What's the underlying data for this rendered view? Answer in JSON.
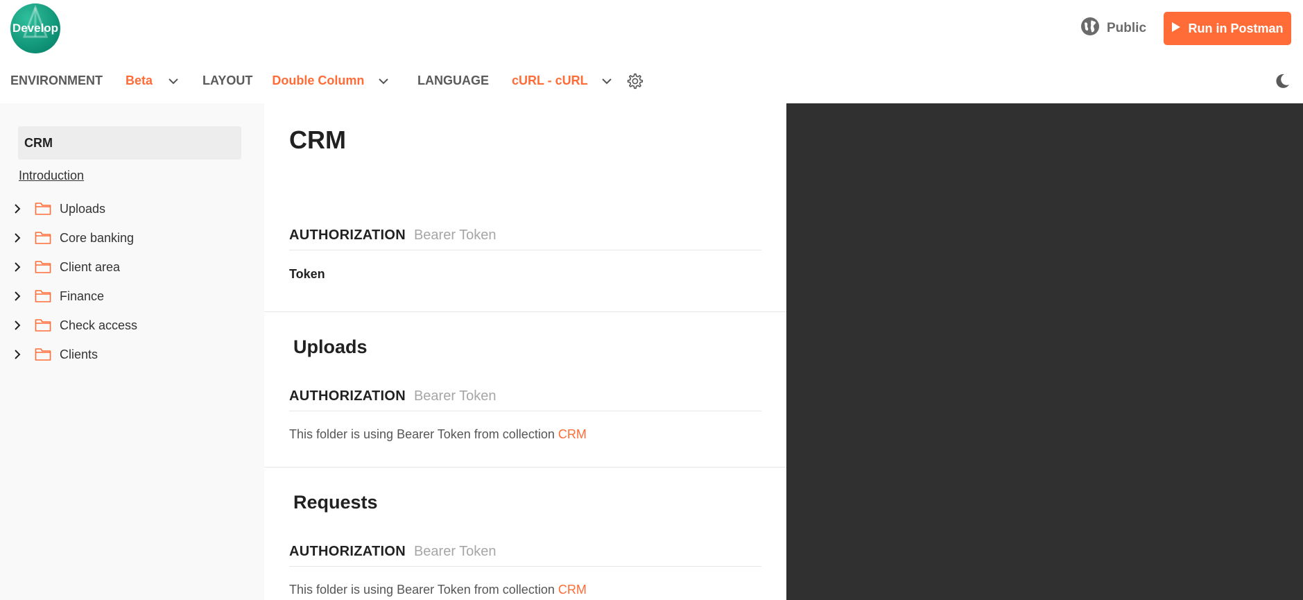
{
  "header": {
    "logo_text": "Develop",
    "visibility_label": "Public",
    "run_button_label": "Run in Postman"
  },
  "toolbar": {
    "environment_label": "ENVIRONMENT",
    "environment_value": "Beta",
    "layout_label": "LAYOUT",
    "layout_value": "Double Column",
    "language_label": "LANGUAGE",
    "language_value": "cURL - cURL"
  },
  "sidebar": {
    "collection_name": "CRM",
    "intro_link": "Introduction",
    "folders": [
      {
        "label": "Uploads"
      },
      {
        "label": "Core banking"
      },
      {
        "label": "Client area"
      },
      {
        "label": "Finance"
      },
      {
        "label": "Check access"
      },
      {
        "label": "Clients"
      }
    ]
  },
  "main": {
    "title": "CRM",
    "collection_auth": {
      "key": "AUTHORIZATION",
      "value": "Bearer Token",
      "field_label": "Token"
    },
    "sections": [
      {
        "title": "Uploads",
        "auth_key": "AUTHORIZATION",
        "auth_value": "Bearer Token",
        "note_text": "This folder is using Bearer Token from collection ",
        "note_link": "CRM"
      },
      {
        "title": "Requests",
        "auth_key": "AUTHORIZATION",
        "auth_value": "Bearer Token",
        "note_text": "This folder is using Bearer Token from collection ",
        "note_link": "CRM"
      }
    ]
  },
  "colors": {
    "accent": "#ff6c37",
    "code_panel_bg": "#303030",
    "sidebar_bg": "#f9f9f9",
    "logo_bg": "#0d8f73"
  },
  "icons": [
    "globe-icon",
    "play-icon",
    "chevron-down-icon",
    "gear-icon",
    "moon-icon",
    "chevron-right-icon",
    "folder-icon"
  ]
}
